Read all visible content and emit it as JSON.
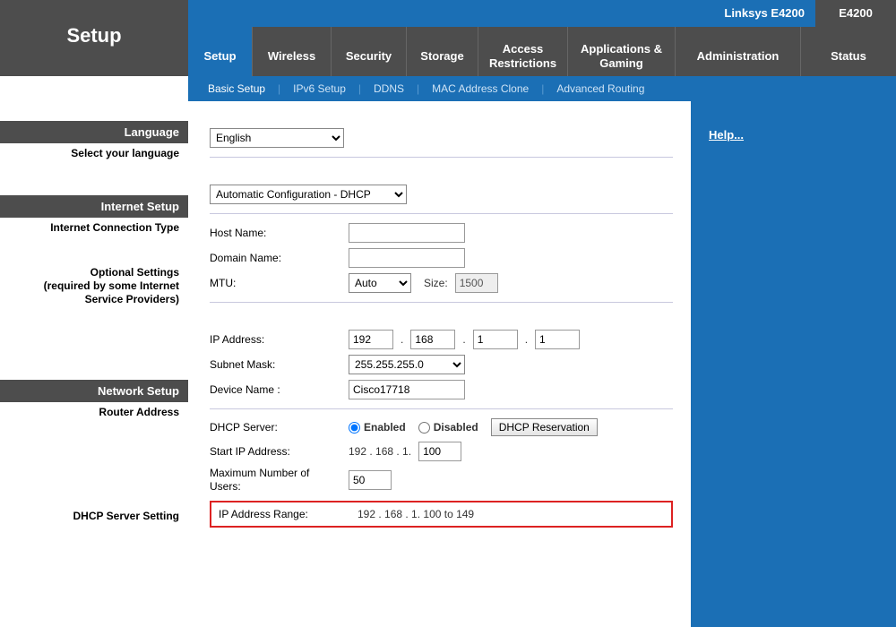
{
  "brand": {
    "model": "Linksys E4200",
    "short": "E4200"
  },
  "page_title": "Setup",
  "nav": [
    {
      "label": "Setup",
      "active": true
    },
    {
      "label": "Wireless"
    },
    {
      "label": "Security"
    },
    {
      "label": "Storage"
    },
    {
      "label": "Access\nRestrictions"
    },
    {
      "label": "Applications &\nGaming"
    },
    {
      "label": "Administration"
    },
    {
      "label": "Status"
    }
  ],
  "subnav": [
    {
      "label": "Basic Setup",
      "active": true
    },
    {
      "label": "IPv6 Setup"
    },
    {
      "label": "DDNS"
    },
    {
      "label": "MAC Address Clone"
    },
    {
      "label": "Advanced Routing"
    }
  ],
  "side": {
    "language_hdr": "Language",
    "language_sub": "Select your language",
    "inet_hdr": "Internet Setup",
    "inet_sub": "Internet Connection Type",
    "optional_hdr": "Optional Settings",
    "optional_sub": "(required by some Internet Service Providers)",
    "net_hdr": "Network Setup",
    "net_sub1": "Router Address",
    "net_sub2": "DHCP Server Setting"
  },
  "form": {
    "language_select": "English",
    "conn_type": "Automatic Configuration - DHCP",
    "host_label": "Host Name:",
    "host_value": "",
    "domain_label": "Domain Name:",
    "domain_value": "",
    "mtu_label": "MTU:",
    "mtu_select": "Auto",
    "size_label": "Size:",
    "size_value": "1500",
    "ip_label": "IP Address:",
    "ip": [
      "192",
      "168",
      "1",
      "1"
    ],
    "mask_label": "Subnet Mask:",
    "mask_select": "255.255.255.0",
    "devname_label": "Device Name :",
    "devname_value": "Cisco17718",
    "dhcp_label": "DHCP Server:",
    "enabled": "Enabled",
    "disabled": "Disabled",
    "reservation_btn": "DHCP Reservation",
    "start_label": "Start IP Address:",
    "start_prefix": "192 . 168 . 1.",
    "start_value": "100",
    "maxusers_label": "Maximum Number of Users:",
    "maxusers_value": "50",
    "range_label": "IP Address Range:",
    "range_value": "192 . 168 . 1. 100 to 149"
  },
  "help": "Help..."
}
